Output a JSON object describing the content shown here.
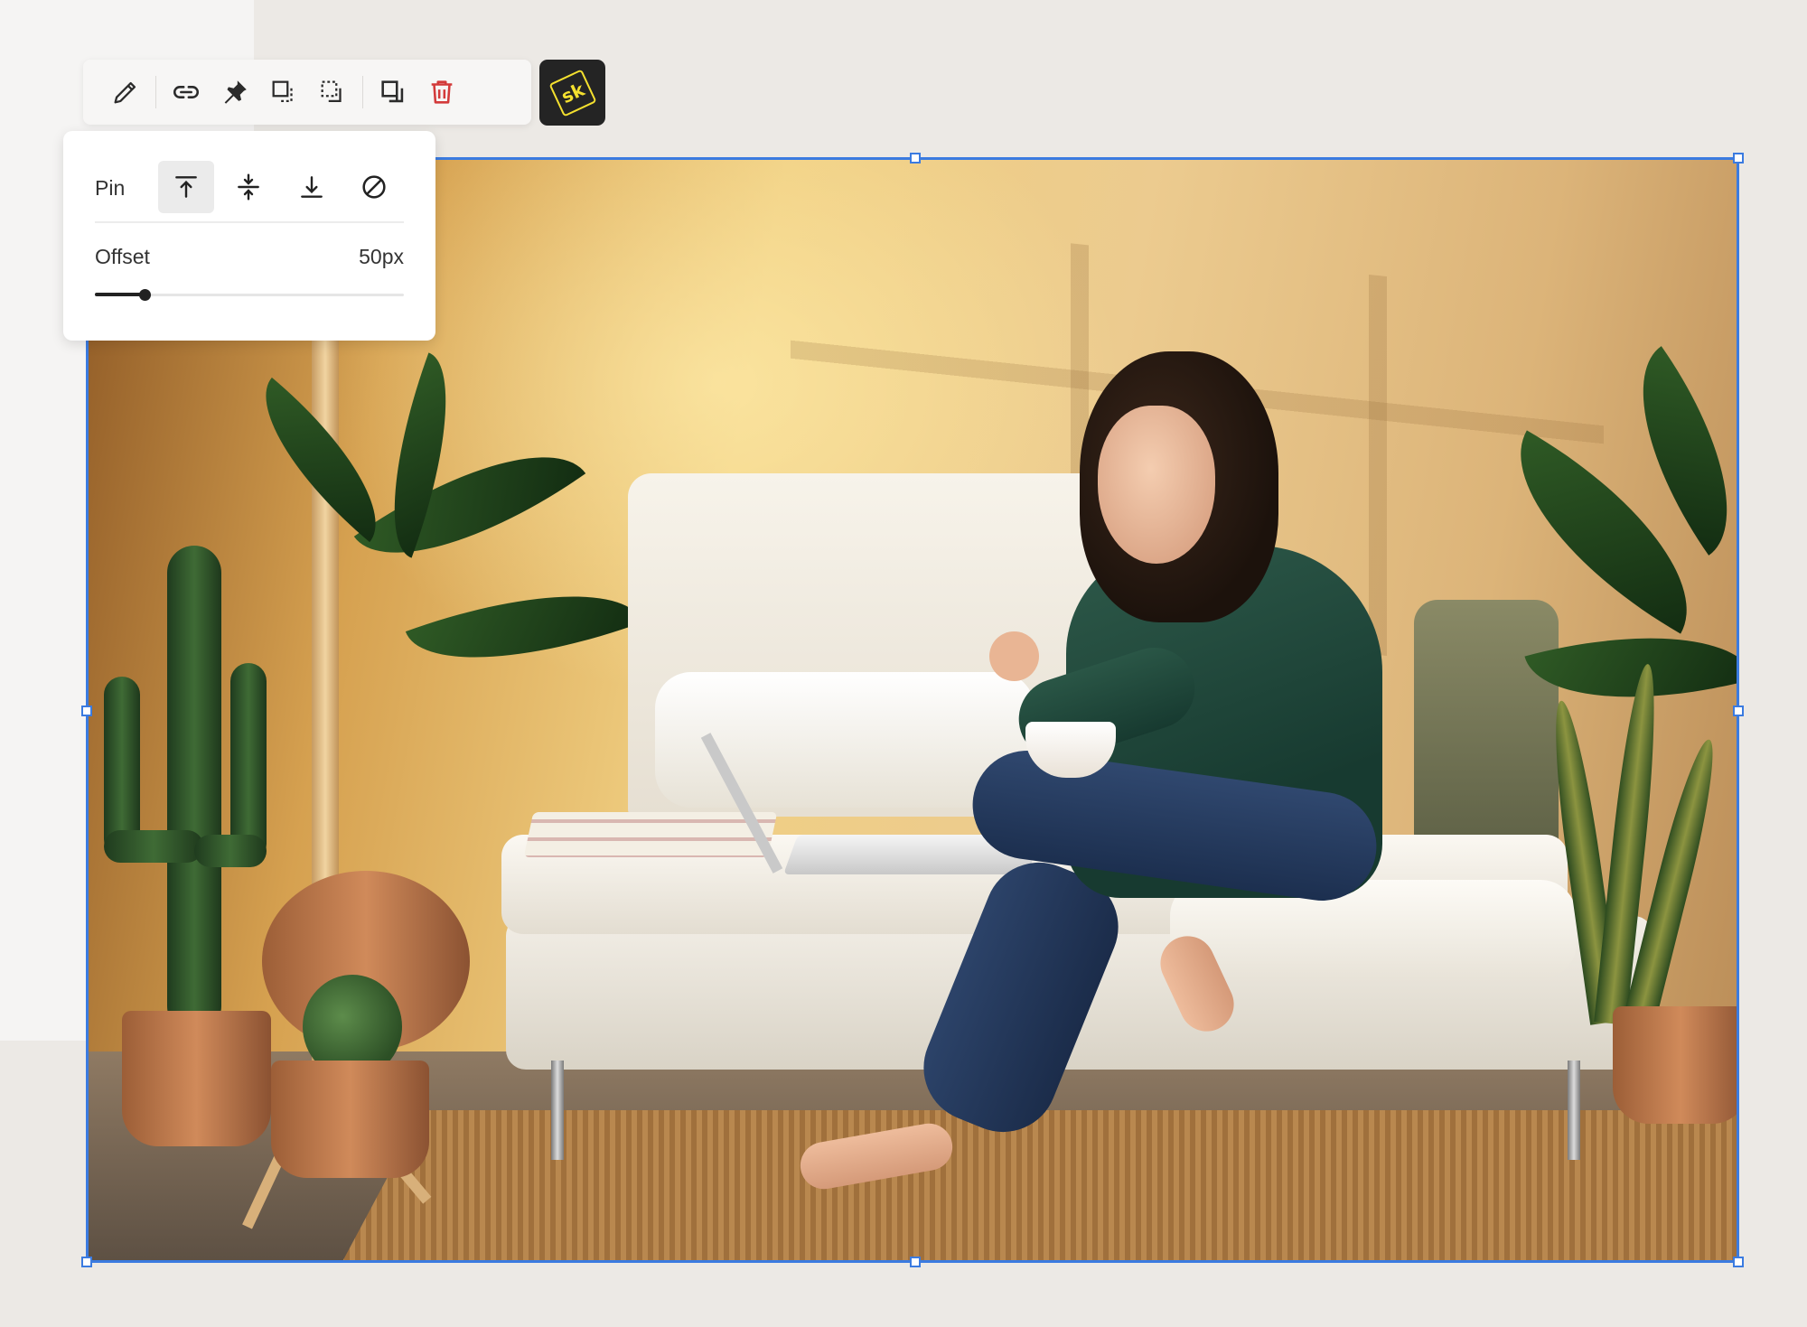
{
  "toolbar": {
    "buttons": [
      {
        "icon": "pencil-icon"
      },
      {
        "icon": "link-icon"
      },
      {
        "icon": "pin-icon"
      },
      {
        "icon": "bring-forward-icon"
      },
      {
        "icon": "send-backward-icon"
      },
      {
        "icon": "duplicate-icon"
      },
      {
        "icon": "trash-icon",
        "color": "#d33a3a"
      }
    ],
    "brand": {
      "icon": "sk-logo",
      "text": "sk",
      "color": "#f4e02f",
      "background": "#242424"
    }
  },
  "pin_panel": {
    "label": "Pin",
    "options": [
      {
        "icon": "pin-top-icon",
        "selected": true
      },
      {
        "icon": "pin-center-icon",
        "selected": false
      },
      {
        "icon": "pin-bottom-icon",
        "selected": false
      },
      {
        "icon": "no-pin-icon",
        "selected": false
      }
    ],
    "offset": {
      "label": "Offset",
      "value_text": "50px",
      "slider_fraction": 0.16
    }
  },
  "selection": {
    "color": "#3b7be0"
  }
}
